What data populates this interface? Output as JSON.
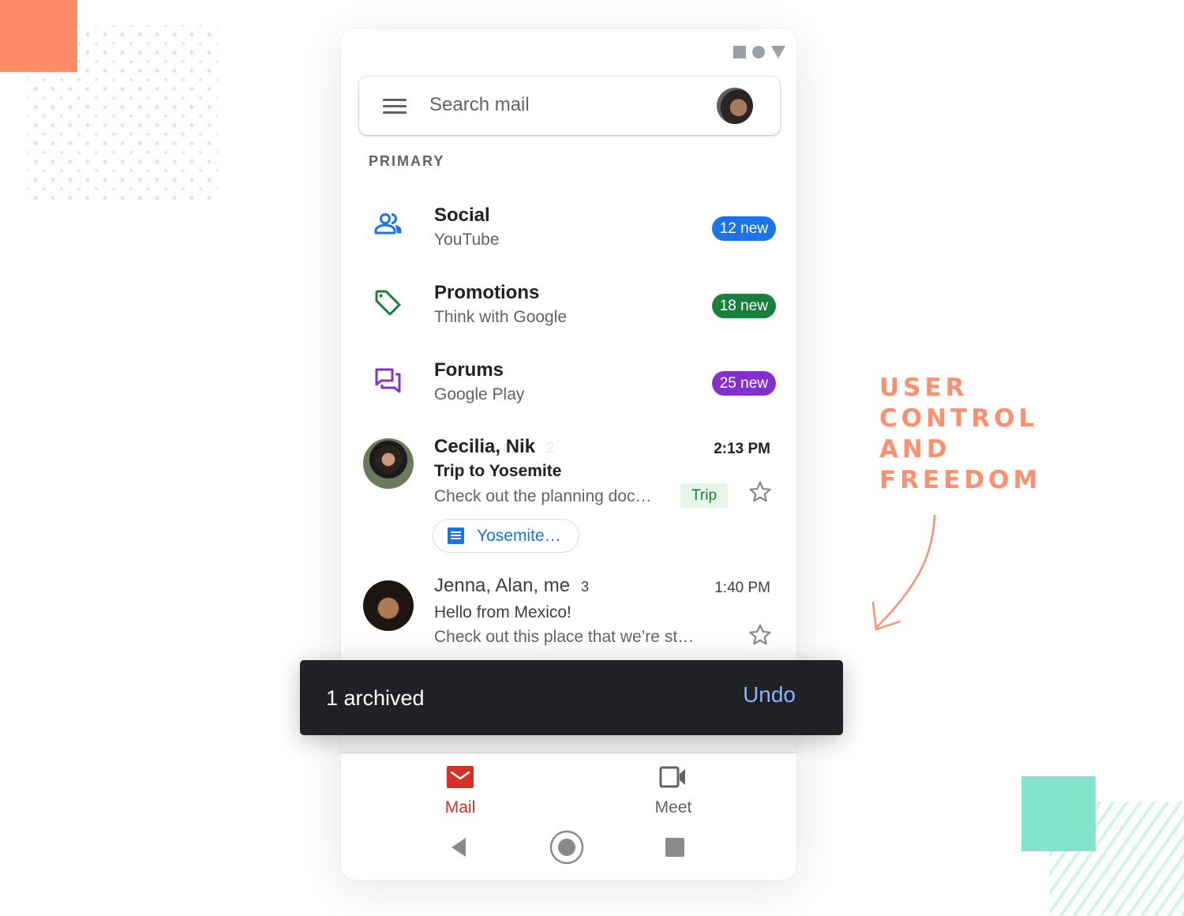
{
  "colors": {
    "accent_orange": "#ff8a6a",
    "accent_teal": "#7fe3c9",
    "social": "#1a73e8",
    "promotions": "#188038",
    "forums": "#8430ce",
    "mail_red": "#d93025",
    "snackbar_bg": "#202124",
    "snackbar_action": "#8ab4f8"
  },
  "caption": {
    "lines": [
      "USER",
      "CONTROL",
      "AND",
      "FREEDOM"
    ]
  },
  "phone": {
    "status_icons": [
      "square-icon",
      "circle-icon",
      "triangle-icon"
    ],
    "search": {
      "placeholder": "Search mail",
      "menu_icon": "hamburger-menu-icon",
      "avatar_icon": "account-avatar"
    },
    "section_label": "PRIMARY",
    "categories": [
      {
        "icon": "people-icon",
        "title": "Social",
        "subtitle": "YouTube",
        "badge": "12 new",
        "color": "#1a73e8"
      },
      {
        "icon": "tag-icon",
        "title": "Promotions",
        "subtitle": "Think with Google",
        "badge": "18 new",
        "color": "#188038"
      },
      {
        "icon": "forum-icon",
        "title": "Forums",
        "subtitle": "Google Play",
        "badge": "25 new",
        "color": "#8430ce"
      }
    ],
    "emails": [
      {
        "sender": "Cecilia, Nik",
        "count": "2",
        "time": "2:13 PM",
        "subject": "Trip to Yosemite",
        "snippet": "Check out the planning doc…",
        "label": "Trip",
        "attachment": "Yosemite…",
        "unread": true,
        "starred": false
      },
      {
        "sender": "Jenna, Alan, me",
        "count": "3",
        "time": "1:40 PM",
        "subject": "Hello from Mexico!",
        "snippet": "Check out this place that we’re st…",
        "unread": false,
        "starred": false
      }
    ],
    "bottom_nav": [
      {
        "icon": "mail-icon",
        "label": "Mail",
        "active": true
      },
      {
        "icon": "video-camera-icon",
        "label": "Meet",
        "active": false
      }
    ],
    "system_nav": [
      "back-icon",
      "home-icon",
      "recents-icon"
    ]
  },
  "snackbar": {
    "message": "1 archived",
    "action": "Undo"
  }
}
